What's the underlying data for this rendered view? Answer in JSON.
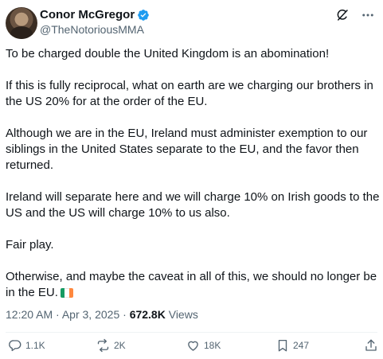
{
  "author": {
    "display_name": "Conor McGregor",
    "handle": "@TheNotoriousMMA",
    "verified_color": "#1d9bf0"
  },
  "header_icons": [
    "grok-icon",
    "more-options-icon"
  ],
  "tweet": {
    "paragraphs": [
      "To be charged double the United Kingdom is an abomination!",
      "If this is fully reciprocal, what on earth are we charging our brothers in the US 20% for at the order of the EU.",
      "Although we are in the EU, Ireland must administer exemption to our siblings in the United States separate to the EU, and the favor then returned.",
      "Ireland will separate here and we will charge 10% on Irish goods to the US and the US will charge 10% to us also.",
      "Fair play.",
      "Otherwise, and maybe the caveat in all of this, we should no longer be in the EU."
    ],
    "flag_emoji": "ireland-flag",
    "flag_colors": [
      "#169b62",
      "#ffffff",
      "#ff883e"
    ]
  },
  "meta": {
    "time": "12:20 AM",
    "date": "Apr 3, 2025",
    "separator": "·",
    "views_count": "672.8K",
    "views_label": "Views"
  },
  "actions": {
    "replies": "1.1K",
    "reposts": "2K",
    "likes": "18K",
    "bookmarks": "247"
  },
  "colors": {
    "text": "#0f1419",
    "secondary": "#536471",
    "divider": "#eff3f4"
  }
}
